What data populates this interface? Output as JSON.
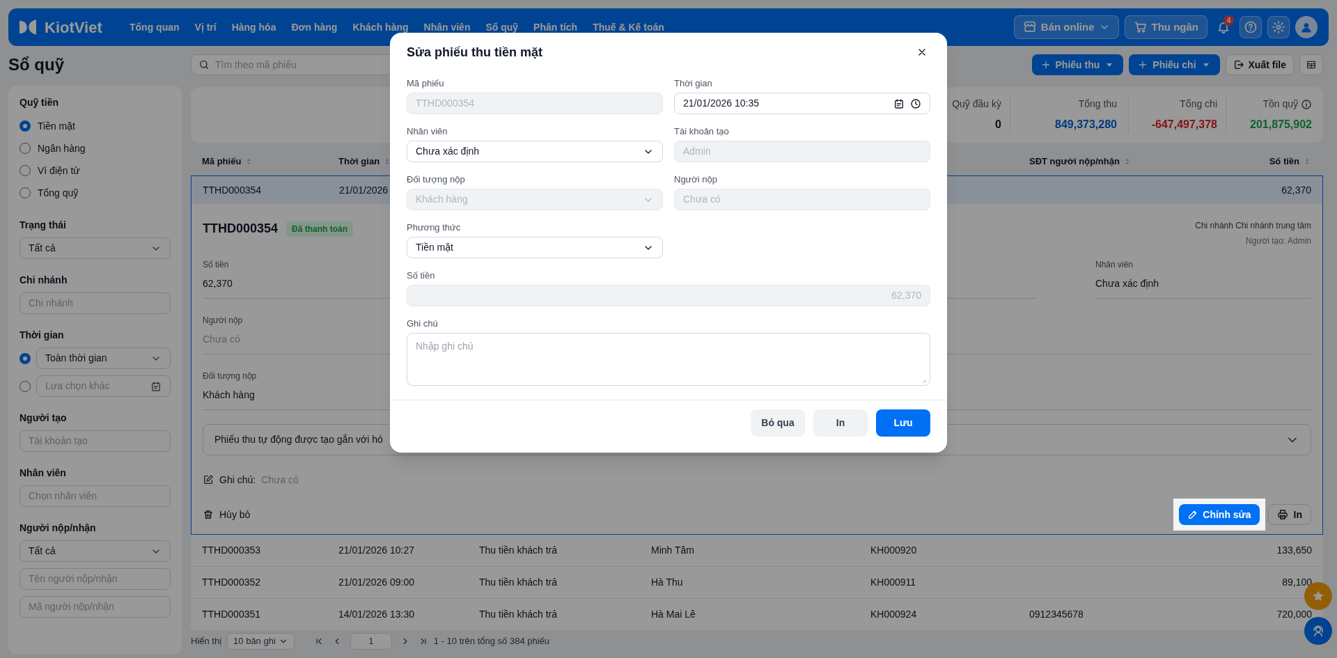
{
  "header": {
    "logo": "KiotViet",
    "nav": [
      "Tổng quan",
      "Vị trí",
      "Hàng hóa",
      "Đơn hàng",
      "Khách hàng",
      "Nhân viên",
      "Sổ quỹ",
      "Phân tích",
      "Thuế & Kế toán"
    ],
    "online_button": "Bán online",
    "cashier_button": "Thu ngân",
    "notification_count": "4"
  },
  "page": {
    "title": "Sổ quỹ",
    "search_placeholder": "Tìm theo mã phiếu",
    "actions": [
      {
        "label": "Phiếu thu",
        "kind": "dropdown"
      },
      {
        "label": "Phiếu chi",
        "kind": "dropdown"
      },
      {
        "label": "Xuất file",
        "kind": "export"
      }
    ]
  },
  "sidebar": {
    "sections": [
      {
        "title": "Quỹ tiền",
        "fields": [
          {
            "kind": "radio",
            "label": "Tiền mặt",
            "selected": true
          },
          {
            "kind": "radio",
            "label": "Ngân hàng",
            "selected": false
          },
          {
            "kind": "radio",
            "label": "Ví điện tử",
            "selected": false
          },
          {
            "kind": "radio",
            "label": "Tổng quỹ",
            "selected": false
          }
        ]
      },
      {
        "title": "Trạng thái",
        "fields": [
          {
            "kind": "select",
            "value": "Tất cả"
          }
        ]
      },
      {
        "title": "Chi nhánh",
        "fields": [
          {
            "kind": "input",
            "placeholder": "Chi nhánh"
          }
        ]
      },
      {
        "title": "Thời gian",
        "fields": [
          {
            "kind": "radio_select",
            "value": "Toàn thời gian",
            "selected": true
          },
          {
            "kind": "radio_date",
            "placeholder": "Lựa chọn khác",
            "selected": false
          }
        ]
      },
      {
        "title": "Người tạo",
        "fields": [
          {
            "kind": "input",
            "placeholder": "Tài khoản tạo"
          }
        ]
      },
      {
        "title": "Nhân viên",
        "fields": [
          {
            "kind": "input",
            "placeholder": "Chọn nhân viên"
          }
        ]
      },
      {
        "title": "Người nộp/nhận",
        "fields": [
          {
            "kind": "select",
            "value": "Tất cả"
          },
          {
            "kind": "input",
            "placeholder": "Tên người nộp/nhận"
          },
          {
            "kind": "input",
            "placeholder": "Mã người nộp/nhận"
          }
        ]
      }
    ]
  },
  "summary": {
    "stats": [
      {
        "label": "Quỹ đầu kỳ",
        "value": "0",
        "info_icon": false
      },
      {
        "label": "Tổng thu",
        "value": "849,373,280",
        "info_icon": false
      },
      {
        "label": "Tổng chi",
        "value": "-647,497,378",
        "info_icon": false
      },
      {
        "label": "Tồn quỹ",
        "value": "201,875,902",
        "info_icon": true
      }
    ]
  },
  "table": {
    "columns": [
      {
        "label": "Mã phiếu"
      },
      {
        "label": "Thời gian"
      },
      {
        "label": "SĐT người nộp/nhận"
      },
      {
        "label": "Số tiền"
      }
    ],
    "rows": [
      {
        "selected": true,
        "expanded": true,
        "ma_phieu": "TTHD000354",
        "thoi_gian": "21/01/2026",
        "so_tien": "62,370"
      },
      {
        "selected": false,
        "expanded": false,
        "ma_phieu": "TTHD000353",
        "thoi_gian": "21/01/2026 10:27",
        "column_3": "Thu tiền khách trả",
        "column_4": "Minh Tâm",
        "column_5": "KH000920",
        "so_tien": "133,650"
      },
      {
        "selected": false,
        "expanded": false,
        "ma_phieu": "TTHD000352",
        "thoi_gian": "21/01/2026 09:00",
        "column_3": "Thu tiền khách trả",
        "column_4": "Hà Thu",
        "column_5": "KH000911",
        "so_tien": "89,100"
      },
      {
        "selected": false,
        "expanded": false,
        "ma_phieu": "TTHD000351",
        "thoi_gian": "14/01/2026 13:30",
        "column_3": "Thu tiền khách trả",
        "column_4": "Hà Mai Lê",
        "column_5": "KH000924",
        "sdt": "0912345678",
        "so_tien": "720,000"
      }
    ],
    "detail": {
      "code": "TTHD000354",
      "status": "Đã thanh toán",
      "branch": "Chi nhánh Chi nhánh trung tâm",
      "creator": "Người tạo: Admin",
      "fields": [
        {
          "label": "Số tiền",
          "value": "62,370",
          "empty": false
        },
        {
          "label": "Nhân viên",
          "value": "Chưa xác định",
          "empty": false
        },
        {
          "label": "Người nộp",
          "value": "Chưa có",
          "empty": true
        },
        {
          "label": "Đối tượng nộp",
          "value": "Khách hàng",
          "empty": false
        }
      ],
      "linked_note": "Phiếu thu tự động được tạo gắn với hó",
      "note_label": "Ghi chú:",
      "note_value": "Chưa có",
      "cancel": "Hủy bỏ",
      "edit": "Chỉnh sửa",
      "print": "In"
    }
  },
  "footer": {
    "show_label": "Hiển thị",
    "page_size": "10 bản ghi",
    "page": "1",
    "summary": "1 - 10 trên tổng số 384 phiếu"
  },
  "modal": {
    "title": "Sửa phiếu thu tiền mặt",
    "fields": [
      {
        "label": "Mã phiếu",
        "kind": "text",
        "value": "TTHD000354",
        "disabled": true
      },
      {
        "label": "Thời gian",
        "kind": "datetime",
        "value": "21/01/2026 10:35",
        "disabled": false
      },
      {
        "label": "Nhân viên",
        "kind": "select",
        "value": "Chưa xác định",
        "disabled": false
      },
      {
        "label": "Tài khoản tạo",
        "kind": "text",
        "value": "Admin",
        "disabled": true
      },
      {
        "label": "Đối tượng nộp",
        "kind": "select",
        "value": "Khách hàng",
        "disabled": true
      },
      {
        "label": "Người nộp",
        "kind": "text",
        "value": "Chưa có",
        "disabled": true
      },
      {
        "label": "Phương thức",
        "kind": "select",
        "value": "Tiền mặt",
        "disabled": false
      },
      {
        "label": "Số tiền",
        "kind": "amount",
        "value": "62,370",
        "disabled": true
      },
      {
        "label": "Ghi chú",
        "kind": "textarea",
        "placeholder": "Nhập ghi chú",
        "disabled": false
      }
    ],
    "buttons": [
      {
        "label": "Bỏ qua",
        "kind": "secondary"
      },
      {
        "label": "In",
        "kind": "secondary"
      },
      {
        "label": "Lưu",
        "kind": "primary"
      }
    ]
  }
}
